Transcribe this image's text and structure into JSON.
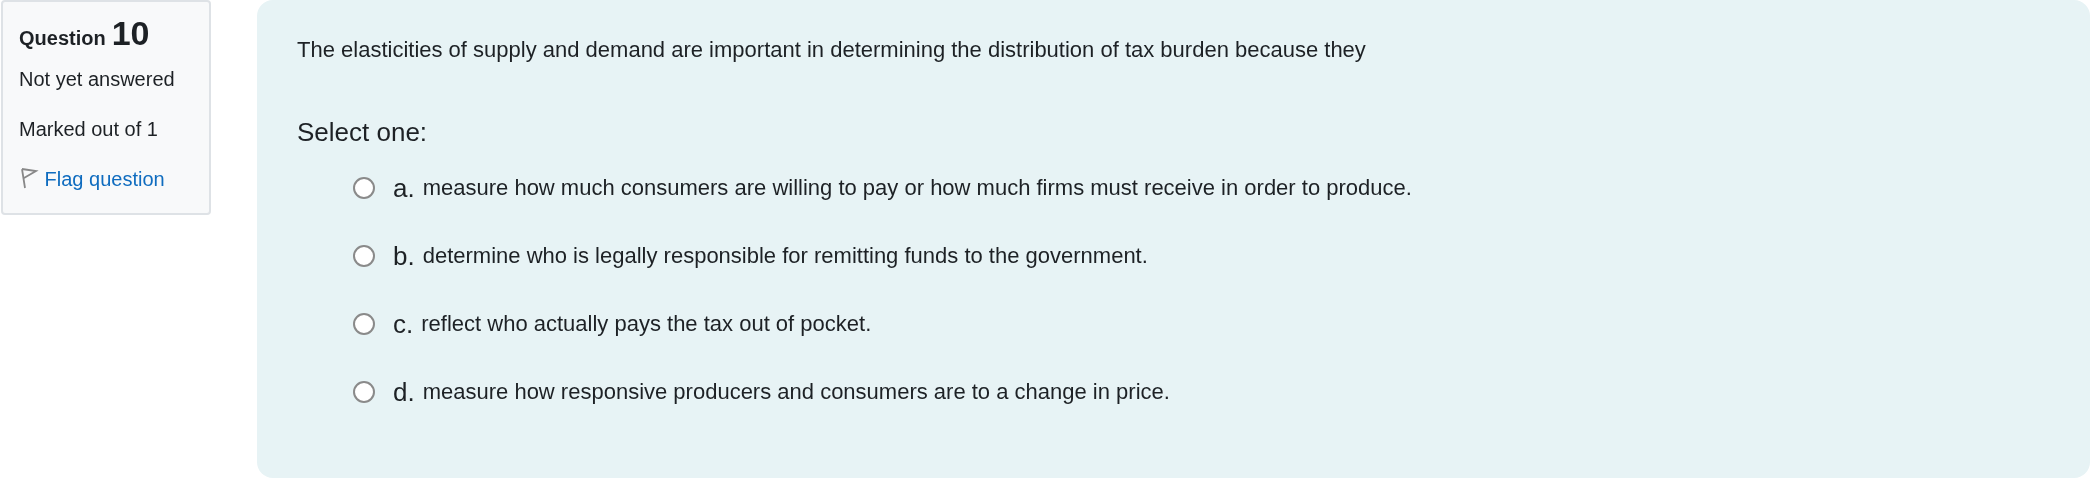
{
  "question_info": {
    "label": "Question",
    "number": "10",
    "state": "Not yet answered",
    "marks": "Marked out of 1",
    "flag": {
      "label": "Flag question",
      "flagged": false
    }
  },
  "question": {
    "text": "The elasticities of supply and demand are important in determining the distribution of tax burden because they",
    "prompt": "Select one:",
    "options": [
      {
        "letter": "a.",
        "text": "measure how much consumers are willing to pay or how much firms must receive in order to produce.",
        "selected": false
      },
      {
        "letter": "b.",
        "text": "determine who is legally responsible for remitting funds to the government.",
        "selected": false
      },
      {
        "letter": "c.",
        "text": "reflect who actually pays the tax out of pocket.",
        "selected": false
      },
      {
        "letter": "d.",
        "text": "measure how responsive producers and consumers are to a change in price.",
        "selected": false
      }
    ]
  }
}
